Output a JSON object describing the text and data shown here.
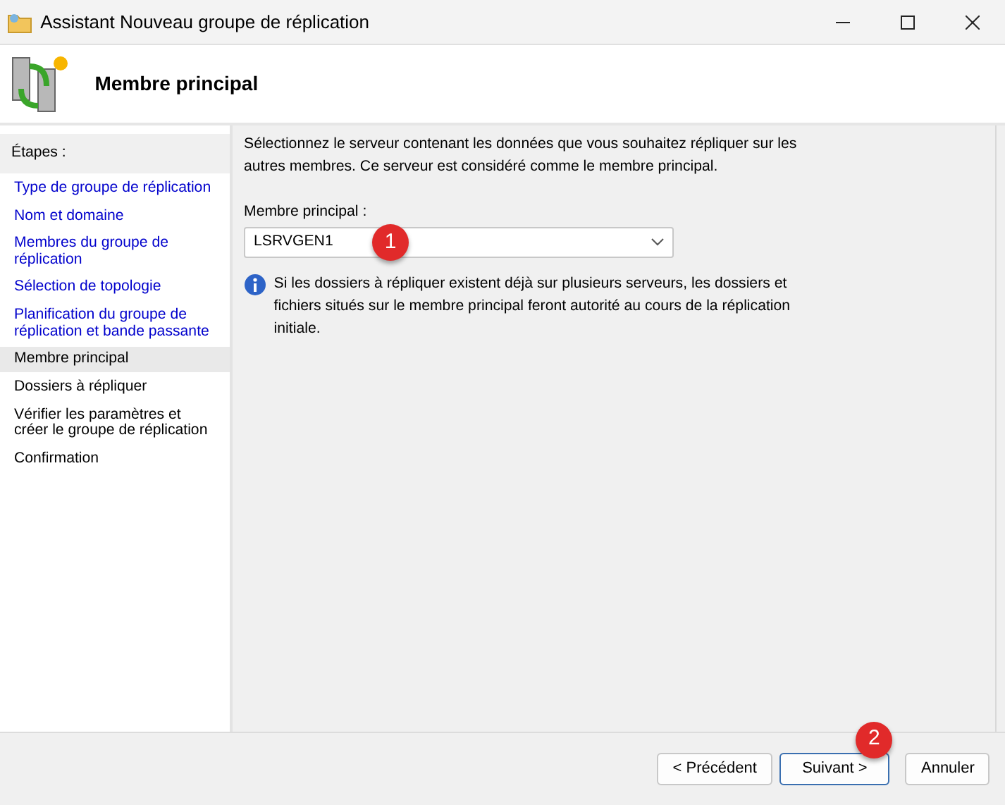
{
  "window": {
    "title": "Assistant Nouveau groupe de réplication"
  },
  "header": {
    "title": "Membre principal"
  },
  "sidebar": {
    "heading": "Étapes :",
    "items": [
      {
        "label": "Type de groupe de réplication",
        "done": true,
        "selected": false
      },
      {
        "label": "Nom et domaine",
        "done": true,
        "selected": false
      },
      {
        "label": "Membres du groupe de réplication",
        "done": true,
        "selected": false
      },
      {
        "label": "Sélection de topologie",
        "done": true,
        "selected": false
      },
      {
        "label": "Planification du groupe de réplication et bande passante",
        "done": true,
        "selected": false
      },
      {
        "label": "Membre principal",
        "done": false,
        "selected": true
      },
      {
        "label": "Dossiers à répliquer",
        "done": false,
        "selected": false
      },
      {
        "label": "Vérifier les paramètres et créer le groupe de réplication",
        "done": false,
        "selected": false
      },
      {
        "label": "Confirmation",
        "done": false,
        "selected": false
      }
    ]
  },
  "main": {
    "intro": "Sélectionnez le serveur contenant les données que vous souhaitez répliquer sur les autres membres. Ce serveur est considéré comme le membre principal.",
    "field_label": "Membre principal :",
    "field_value": "LSRVGEN1",
    "field_marker": "1",
    "info": "Si les dossiers à répliquer existent déjà sur plusieurs serveurs, les dossiers et fichiers situés sur le membre principal feront autorité au cours de la réplication initiale."
  },
  "buttons": [
    {
      "label": "< Précédent",
      "default": false
    },
    {
      "label": "Suivant >",
      "default": true,
      "marker": "2"
    },
    {
      "label": "Annuler",
      "default": false
    }
  ]
}
